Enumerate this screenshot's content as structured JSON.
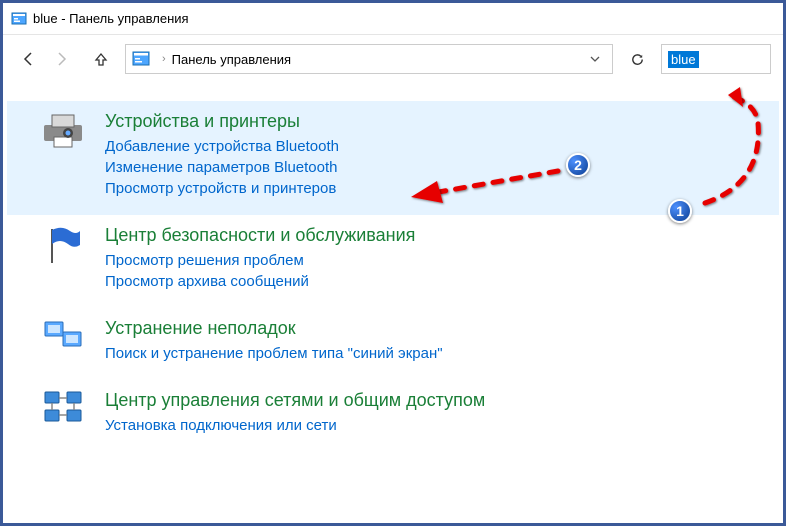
{
  "window": {
    "title": "blue - Панель управления"
  },
  "toolbar": {
    "breadcrumb": "Панель управления",
    "search_value": "blue"
  },
  "results": [
    {
      "title": "Устройства и принтеры",
      "links": [
        "Добавление устройства Bluetooth",
        "Изменение параметров Bluetooth",
        "Просмотр устройств и принтеров"
      ]
    },
    {
      "title": "Центр безопасности и обслуживания",
      "links": [
        "Просмотр решения проблем",
        "Просмотр архива сообщений"
      ]
    },
    {
      "title": "Устранение неполадок",
      "links": [
        "Поиск и устранение проблем типа \"синий экран\""
      ]
    },
    {
      "title": "Центр управления сетями и общим доступом",
      "links": [
        "Установка подключения или сети"
      ]
    }
  ],
  "annotations": {
    "badge1": "1",
    "badge2": "2"
  }
}
